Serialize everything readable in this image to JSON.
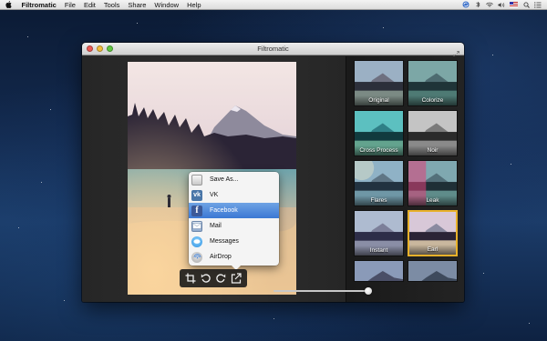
{
  "menubar": {
    "app_name": "Filtromatic",
    "items": [
      "File",
      "Edit",
      "Tools",
      "Share",
      "Window",
      "Help"
    ]
  },
  "window": {
    "title": "Filtromatic"
  },
  "share_menu": {
    "items": [
      {
        "label": "Save As...",
        "icon": "save-icon"
      },
      {
        "label": "VK",
        "icon": "vk-icon"
      },
      {
        "label": "Facebook",
        "icon": "facebook-icon",
        "selected": true
      },
      {
        "label": "Mail",
        "icon": "mail-icon"
      },
      {
        "label": "Messages",
        "icon": "messages-icon"
      },
      {
        "label": "AirDrop",
        "icon": "airdrop-icon"
      }
    ]
  },
  "toolbar": {
    "tools": [
      "crop-icon",
      "rotate-left-icon",
      "rotate-right-icon",
      "share-icon"
    ]
  },
  "filters": {
    "items": [
      {
        "label": "Original"
      },
      {
        "label": "Colorize"
      },
      {
        "label": "Cross Process"
      },
      {
        "label": "Noir"
      },
      {
        "label": "Flares"
      },
      {
        "label": "Leak"
      },
      {
        "label": "Instant"
      },
      {
        "label": "Earl",
        "selected": true
      },
      {
        "label": ""
      },
      {
        "label": ""
      }
    ],
    "intensity": 1.0
  },
  "colors": {
    "selection": "#3b78d4",
    "active_filter_border": "#e8b12a",
    "window_bg": "#2b2b2b"
  }
}
